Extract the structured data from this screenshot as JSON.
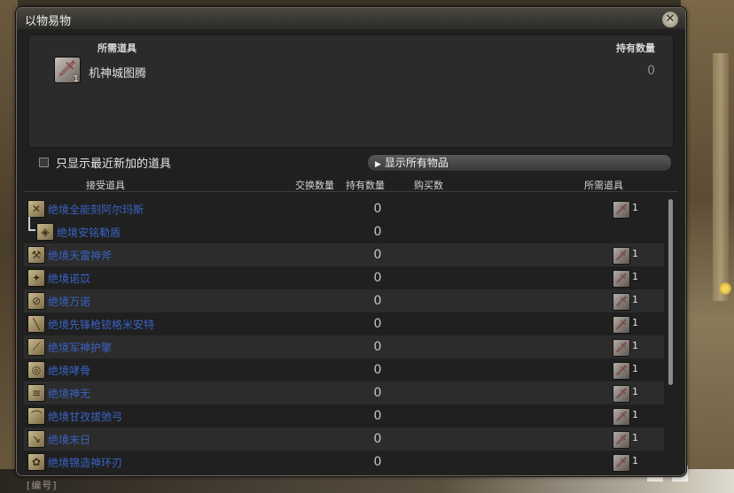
{
  "window": {
    "title": "以物易物",
    "close_icon": "close-icon"
  },
  "required_panel": {
    "header_item": "所需道具",
    "header_owned": "持有数量",
    "item_name": "机神城图腾",
    "item_qty_badge": "1",
    "owned_value": "0"
  },
  "filter": {
    "checkbox_label": "只显示最近新加的道具",
    "checked": false
  },
  "show_all_button": "显示所有物品",
  "columns": {
    "receive_item": "接受道具",
    "exchange_qty": "交换数量",
    "owned": "持有数量",
    "buy": "购买数",
    "required": "所需道具"
  },
  "rows": [
    {
      "name": "绝境全能刻阿尔玛斯",
      "owned": "0",
      "cost": "1",
      "icon": "swords-icon",
      "sub": false,
      "alt": false
    },
    {
      "name": "绝境安铭勒盾",
      "owned": "0",
      "cost": "",
      "icon": "shield-icon",
      "sub": true,
      "alt": false
    },
    {
      "name": "绝境天雷神斧",
      "owned": "0",
      "cost": "1",
      "icon": "axe-icon",
      "sub": false,
      "alt": true
    },
    {
      "name": "绝境诺苡",
      "owned": "0",
      "cost": "1",
      "icon": "polearm-icon",
      "sub": false,
      "alt": false
    },
    {
      "name": "绝境万诺",
      "owned": "0",
      "cost": "1",
      "icon": "fist-icon",
      "sub": false,
      "alt": true
    },
    {
      "name": "绝境先锋枪铳格米安特",
      "owned": "0",
      "cost": "1",
      "icon": "gunblade-icon",
      "sub": false,
      "alt": false
    },
    {
      "name": "绝境军神护擎",
      "owned": "0",
      "cost": "1",
      "icon": "staff-icon",
      "sub": false,
      "alt": true
    },
    {
      "name": "绝境哮骨",
      "owned": "0",
      "cost": "1",
      "icon": "chakram-icon",
      "sub": false,
      "alt": false
    },
    {
      "name": "绝境神无",
      "owned": "0",
      "cost": "1",
      "icon": "katana-icon",
      "sub": false,
      "alt": true
    },
    {
      "name": "绝境甘孜拔弛弓",
      "owned": "0",
      "cost": "1",
      "icon": "bow-icon",
      "sub": false,
      "alt": false
    },
    {
      "name": "绝境末日",
      "owned": "0",
      "cost": "1",
      "icon": "gun-icon",
      "sub": false,
      "alt": true
    },
    {
      "name": "绝境锦造神环刃",
      "owned": "0",
      "cost": "1",
      "icon": "ring-blade-icon",
      "sub": false,
      "alt": false
    }
  ],
  "chat_snippet": "[编号]"
}
